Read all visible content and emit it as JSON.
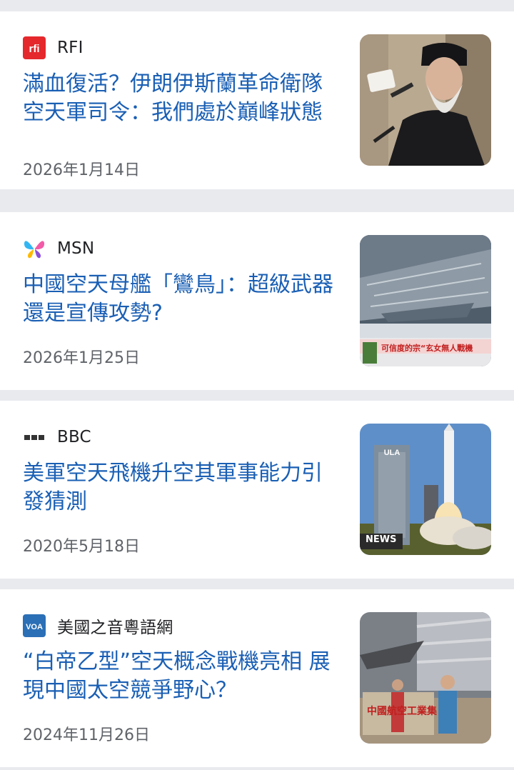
{
  "articles": [
    {
      "source": "RFI",
      "source_icon": "rfi-logo-icon",
      "title": "滿血復活？伊朗伊斯蘭革命衛隊空天軍司令：我們處於巔峰狀態",
      "date": "2026年1月14日",
      "thumbnail": "cleric-speaking-photo"
    },
    {
      "source": "MSN",
      "source_icon": "msn-butterfly-icon",
      "title": "中國空天母艦「鸞鳥」：超級武器還是宣傳攻勢?",
      "date": "2026年1月25日",
      "thumbnail": "spaceship-render-photo",
      "thumbnail_caption": "可信度的宗“玄女無人戰機"
    },
    {
      "source": "BBC",
      "source_icon": "bbc-logo-icon",
      "title": "美軍空天飛機升空其軍事能力引發猜測",
      "date": "2020年5月18日",
      "thumbnail": "rocket-launch-photo",
      "thumbnail_caption": "NEWS"
    },
    {
      "source": "美國之音粵語網",
      "source_icon": "voa-logo-icon",
      "title": "“白帝乙型”空天概念戰機亮相 展現中國太空競爭野心？",
      "date": "2024年11月26日",
      "thumbnail": "aircraft-model-photo",
      "thumbnail_caption": "中國航空工業集"
    }
  ],
  "colors": {
    "title": "#1a5fb4",
    "date": "#5f6368",
    "rfi": "#e4282c",
    "voa": "#2b6fb6",
    "separator": "#e9eaee"
  }
}
